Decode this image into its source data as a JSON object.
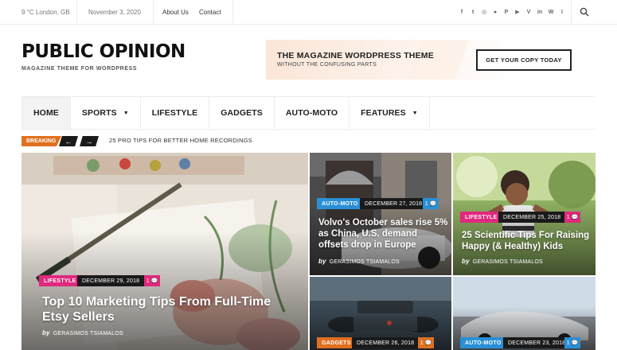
{
  "topbar": {
    "weather": "9 °C London, GB",
    "date": "November 3, 2020",
    "links": [
      "About Us",
      "Contact"
    ],
    "social_icons": [
      "facebook-icon",
      "twitter-icon",
      "instagram-icon",
      "reddit-icon",
      "pinterest-icon",
      "youtube-icon",
      "vimeo-icon",
      "linkedin-icon",
      "wordpress-icon",
      "rss-icon"
    ],
    "social_glyphs": [
      "f",
      "t",
      "◎",
      "●",
      "P",
      "▶",
      "V",
      "in",
      "W",
      "⌇"
    ]
  },
  "header": {
    "logo": "PUBLIC OPINION",
    "tagline": "MAGAZINE THEME FOR WORDPRESS"
  },
  "banner": {
    "title": "THE MAGAZINE WORDPRESS THEME",
    "subtitle": "WITHOUT THE CONFUSING PARTS",
    "button": "GET YOUR COPY TODAY"
  },
  "nav": {
    "items": [
      {
        "label": "HOME",
        "active": true,
        "dropdown": false
      },
      {
        "label": "SPORTS",
        "active": false,
        "dropdown": true
      },
      {
        "label": "LIFESTYLE",
        "active": false,
        "dropdown": false
      },
      {
        "label": "GADGETS",
        "active": false,
        "dropdown": false
      },
      {
        "label": "AUTO-MOTO",
        "active": false,
        "dropdown": false
      },
      {
        "label": "FEATURES",
        "active": false,
        "dropdown": true
      }
    ]
  },
  "breaking": {
    "label": "BREAKING",
    "prev": "←",
    "next": "→",
    "headline": "25 PRO TIPS FOR BETTER HOME RECORDINGS"
  },
  "colors": {
    "lifestyle": "#e0287d",
    "auto_moto": "#2a8fd6",
    "gadgets": "#e0701f",
    "breaking": "#e0701f"
  },
  "posts": [
    {
      "category": "LIFESTYLE",
      "date": "DECEMBER 29, 2018",
      "comments": "1",
      "title": "Top 10 Marketing Tips From Full-Time Etsy Sellers",
      "author": "GERASIMOS TSIAMALOS"
    },
    {
      "category": "AUTO-MOTO",
      "date": "DECEMBER 27, 2018",
      "comments": "1",
      "title": "Volvo's October sales rise 5% as China, U.S. demand offsets drop in Europe",
      "author": "GERASIMOS TSIAMALOS"
    },
    {
      "category": "LIFESTYLE",
      "date": "DECEMBER 25, 2018",
      "comments": "1",
      "title": "25 Scientific Tips For Raising Happy (& Healthy) Kids",
      "author": "GERASIMOS TSIAMALOS"
    },
    {
      "category": "GADGETS",
      "date": "DECEMBER 26, 2018",
      "comments": "1"
    },
    {
      "category": "AUTO-MOTO",
      "date": "DECEMBER 23, 2018",
      "comments": "1"
    }
  ]
}
